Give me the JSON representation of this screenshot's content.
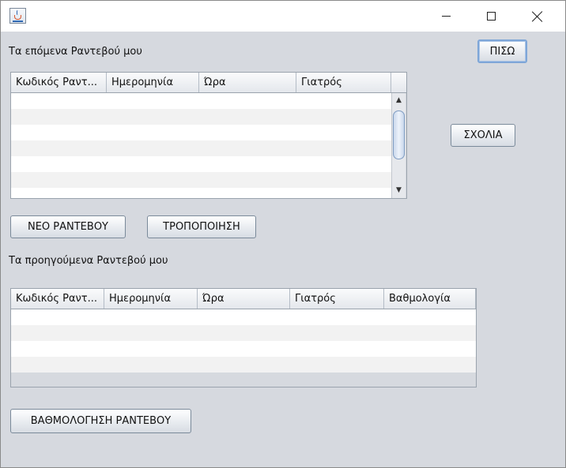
{
  "window": {
    "icon": "java-cup-icon",
    "controls": {
      "minimize": "minimize-icon",
      "maximize": "maximize-icon",
      "close": "close-icon"
    }
  },
  "upcoming": {
    "title": "Τα επόμενα Ραντεβού μου",
    "columns": [
      "Κωδικός Ραντ...",
      "Ημερομηνία",
      "Ώρα",
      "Γιατρός"
    ],
    "row_count": 6
  },
  "buttons": {
    "back": "ΠΙΣΩ",
    "comments": "ΣΧΟΛΙΑ",
    "new_appointment": "ΝΕΟ ΡΑΝΤΕΒΟΥ",
    "modify": "ΤΡΟΠΟΠΟΙΗΣΗ",
    "rate_appointment": "ΒΑΘΜΟΛΟΓΗΣΗ ΡΑΝΤΕΒΟΥ"
  },
  "previous": {
    "title": "Τα προηγούμενα Ραντεβού μου",
    "columns": [
      "Κωδικός Ραντ...",
      "Ημερομηνία",
      "Ώρα",
      "Γιατρός",
      "Βαθμολογία"
    ],
    "row_count": 4
  },
  "scrollbar": {
    "up_arrow": "▲",
    "down_arrow": "▼"
  }
}
